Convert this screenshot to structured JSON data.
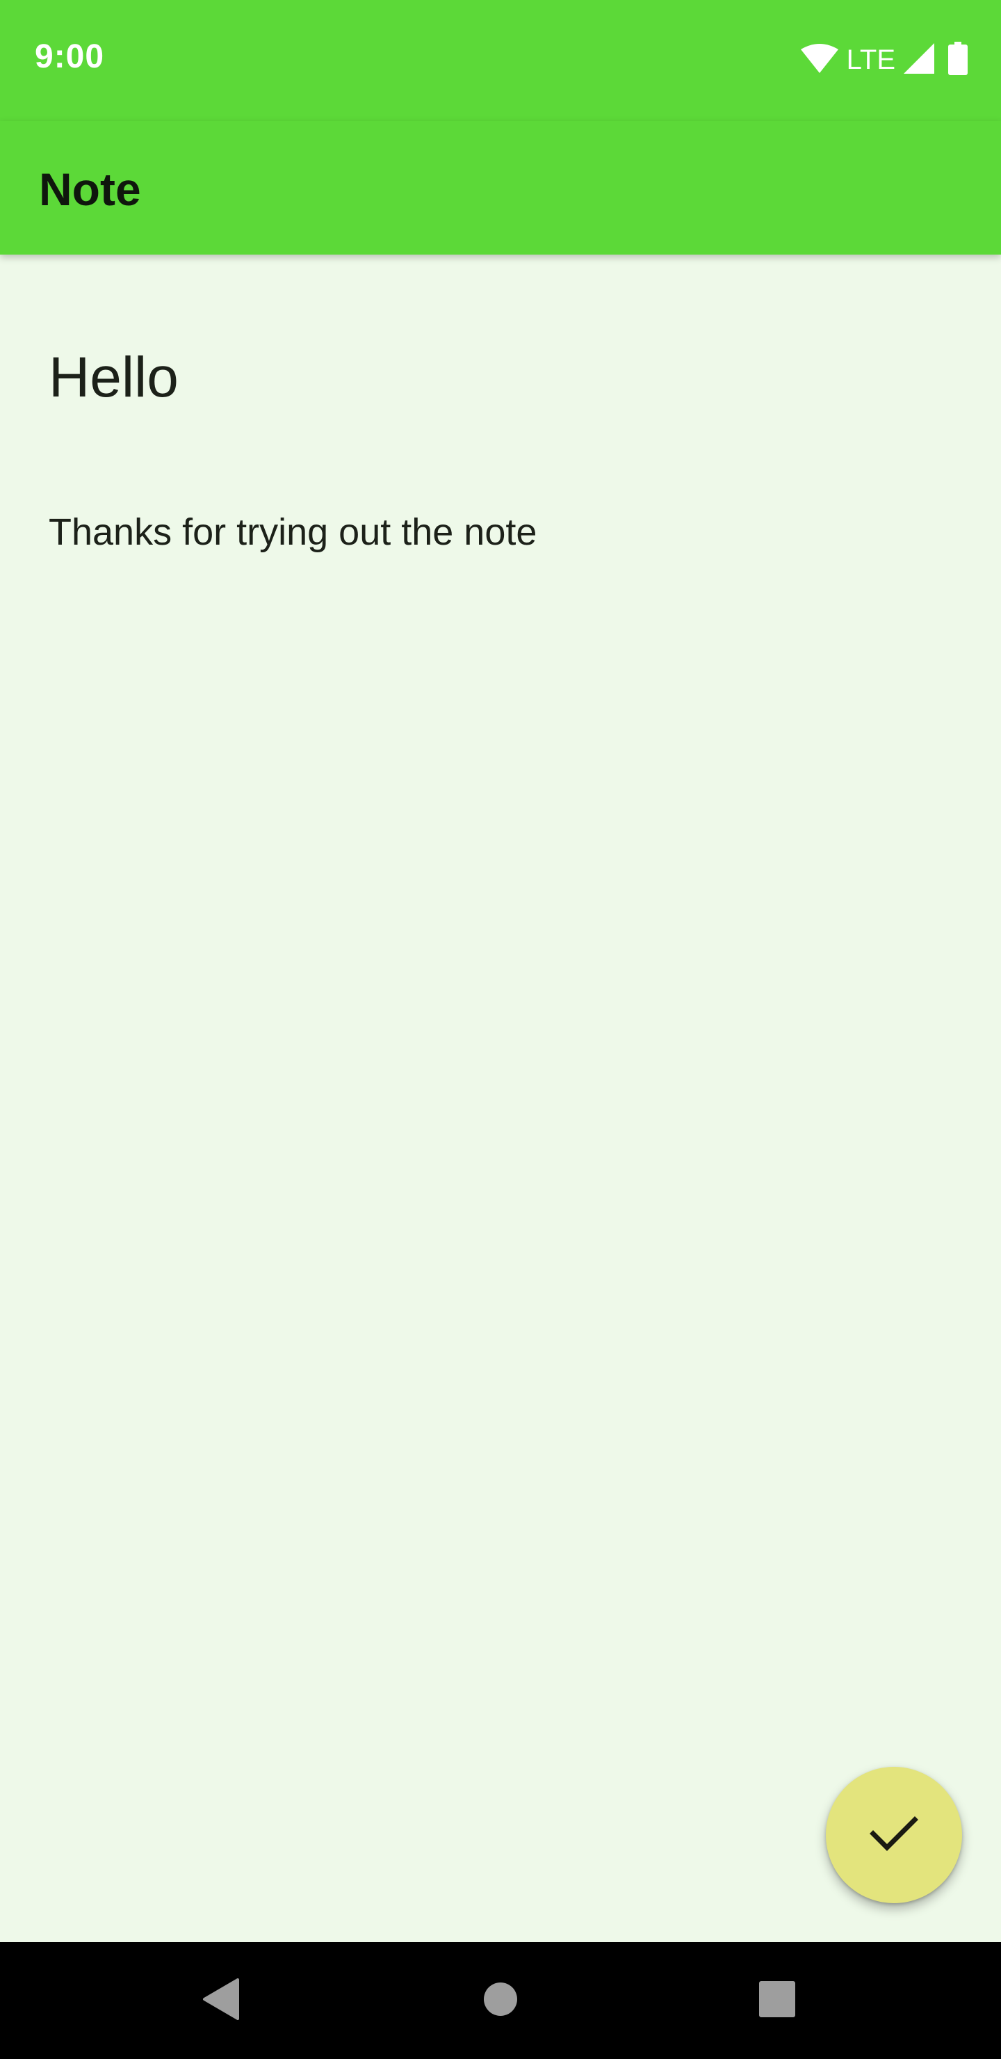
{
  "status_bar": {
    "time": "9:00",
    "network_label": "LTE",
    "icons": [
      "wifi-icon",
      "signal-icon",
      "battery-icon"
    ]
  },
  "app_bar": {
    "title": "Note"
  },
  "note": {
    "title": "Hello",
    "body": "Thanks for trying out the note"
  },
  "fab": {
    "icon": "check-icon"
  },
  "nav_bar": {
    "icons": [
      "back-icon",
      "home-icon",
      "recents-icon"
    ]
  },
  "colors": {
    "app_bar": "#5cd938",
    "background": "#eef9e9",
    "fab": "#e3e47d",
    "nav_bar": "#000000",
    "text": "#1c2119"
  }
}
